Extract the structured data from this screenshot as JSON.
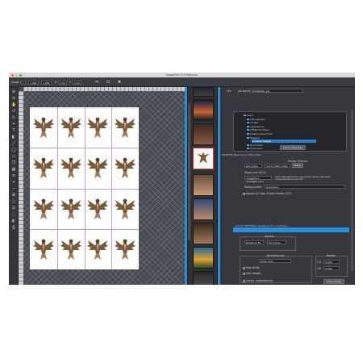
{
  "window": {
    "title": "ImagePrint 9.0 Platinum"
  },
  "toolbar": {
    "image_label": "Image #",
    "image_value": "1",
    "width_value": "1.984",
    "height_value": "1.884",
    "x_label": "X",
    "x_value": "0.00",
    "y_label": "Y",
    "y_value": "0.00",
    "zoom_value": "100"
  },
  "tools": [
    "zoom-in-icon",
    "zoom-out-icon",
    "hand-icon",
    "rotate-left-icon",
    "rotate-right-icon",
    "crop-icon",
    "text-icon",
    "fill-icon",
    "line-icon",
    "ellipse-icon",
    "rect-icon",
    "layer-icon",
    "grid-icon",
    "align-icon",
    "add-icon",
    "delete-icon",
    "lock-icon",
    "info-icon"
  ],
  "layout": {
    "rows": 4,
    "cols": 4
  },
  "right_panel": {
    "file_label": "File",
    "job_name_label": "Job Name",
    "job_name_value": "DSCN0086_jpg",
    "tree_items": [
      "Users",
      "administrator",
      "CF-Mac",
      "Applications",
      "CTP&R Container",
      "Creative Cloud Files",
      "Desktop",
      "Canon Images",
      "Documents",
      "Downloads"
    ],
    "selected_tree_item": "Canon Images",
    "add_to_favorites": "Add to Favorites",
    "printer_section": "PRINTER: Best Canon PRO-1000",
    "printer_selector_label": "Printer Selector",
    "media_value": "Roll paper",
    "printer_value": "Canon iPRO-1000",
    "setup_label": "Setup",
    "pages_label": "Pages and 16.00",
    "color_mgmt_label": "ImagePrint manages color",
    "color_mgmt_note": "Color Management in the printer driver has been Automatically turned Off",
    "rating_label": "Rating profile",
    "rating_value": "Automatic",
    "speed_label": "Speed Up Color Printer Profile (ICS)",
    "layout_section": "LAYOUT SETTINGS: Rotate to Fit, 1.0 (Sides)",
    "layout_label": "Layout",
    "rotate_value": "Rotate to Fit",
    "fit_value": "No Frame",
    "bounding_label": "Bounding box",
    "proportional_value": "Photo Size",
    "max_width_label": "Max Width",
    "max_height_label": "Max Height",
    "center_label": "Center automatically",
    "border_label": "Border",
    "border_l_label": "L.R",
    "border_l_value": "0.400",
    "border_t_label": "T.B",
    "border_t_value": "0.400",
    "show_poster_label": "Show Poster"
  },
  "colors": {
    "accent": "#2b8fd8",
    "selection_border": "#d13a3a",
    "grid_line": "#c59ad6"
  }
}
